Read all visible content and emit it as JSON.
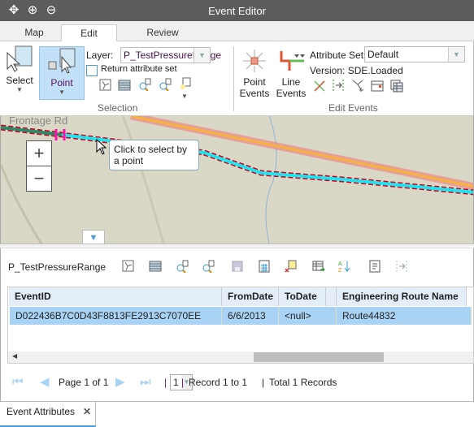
{
  "window": {
    "title": "Event Editor",
    "toolbar_icons": [
      "pan-icon",
      "zoom-in-icon",
      "zoom-out-icon"
    ]
  },
  "tabs": [
    {
      "label": "Map"
    },
    {
      "label": "Edit",
      "active": true
    },
    {
      "label": "Review"
    }
  ],
  "ribbon": {
    "selection": {
      "group_label": "Selection",
      "select_label": "Select",
      "point_label": "Point",
      "layer_label": "Layer:",
      "layer_value": "P_TestPressureRange",
      "return_attr_label": "Return attribute set",
      "return_attr_checked": false
    },
    "edit_events": {
      "group_label": "Edit Events",
      "point_events": "Point\nEvents",
      "point_events_l1": "Point",
      "point_events_l2": "Events",
      "line_events_l1": "Line",
      "line_events_l2": "Events",
      "attr_set_label": "Attribute Set:",
      "attr_set_value": "Default",
      "version_text": "Version: SDE.Loaded"
    }
  },
  "map": {
    "road_label": "Frontage Rd",
    "tooltip": "Click to select by a point",
    "zoom_in": "+",
    "zoom_out": "−"
  },
  "attributes": {
    "layer_name": "P_TestPressureRange",
    "columns": [
      "EventID",
      "FromDate",
      "ToDate",
      "Engineering Route Name"
    ],
    "rows": [
      [
        "D022436B7C0D43F8813FE2913C7070EE",
        "6/6/2013",
        "<null>",
        "Route44832"
      ]
    ],
    "pager": {
      "page_text": "Page 1 of 1",
      "page_select": "1",
      "record_text": "Record 1 to 1",
      "total_text": "Total 1 Records"
    }
  },
  "bottom_tabs": [
    {
      "label": "Event Attributes",
      "closable": true
    }
  ],
  "colors": {
    "titlebar": "#5c5c5c",
    "selected_row": "#a9d3f5",
    "header": "#e3eef9",
    "accent": "#4a9ad8"
  }
}
